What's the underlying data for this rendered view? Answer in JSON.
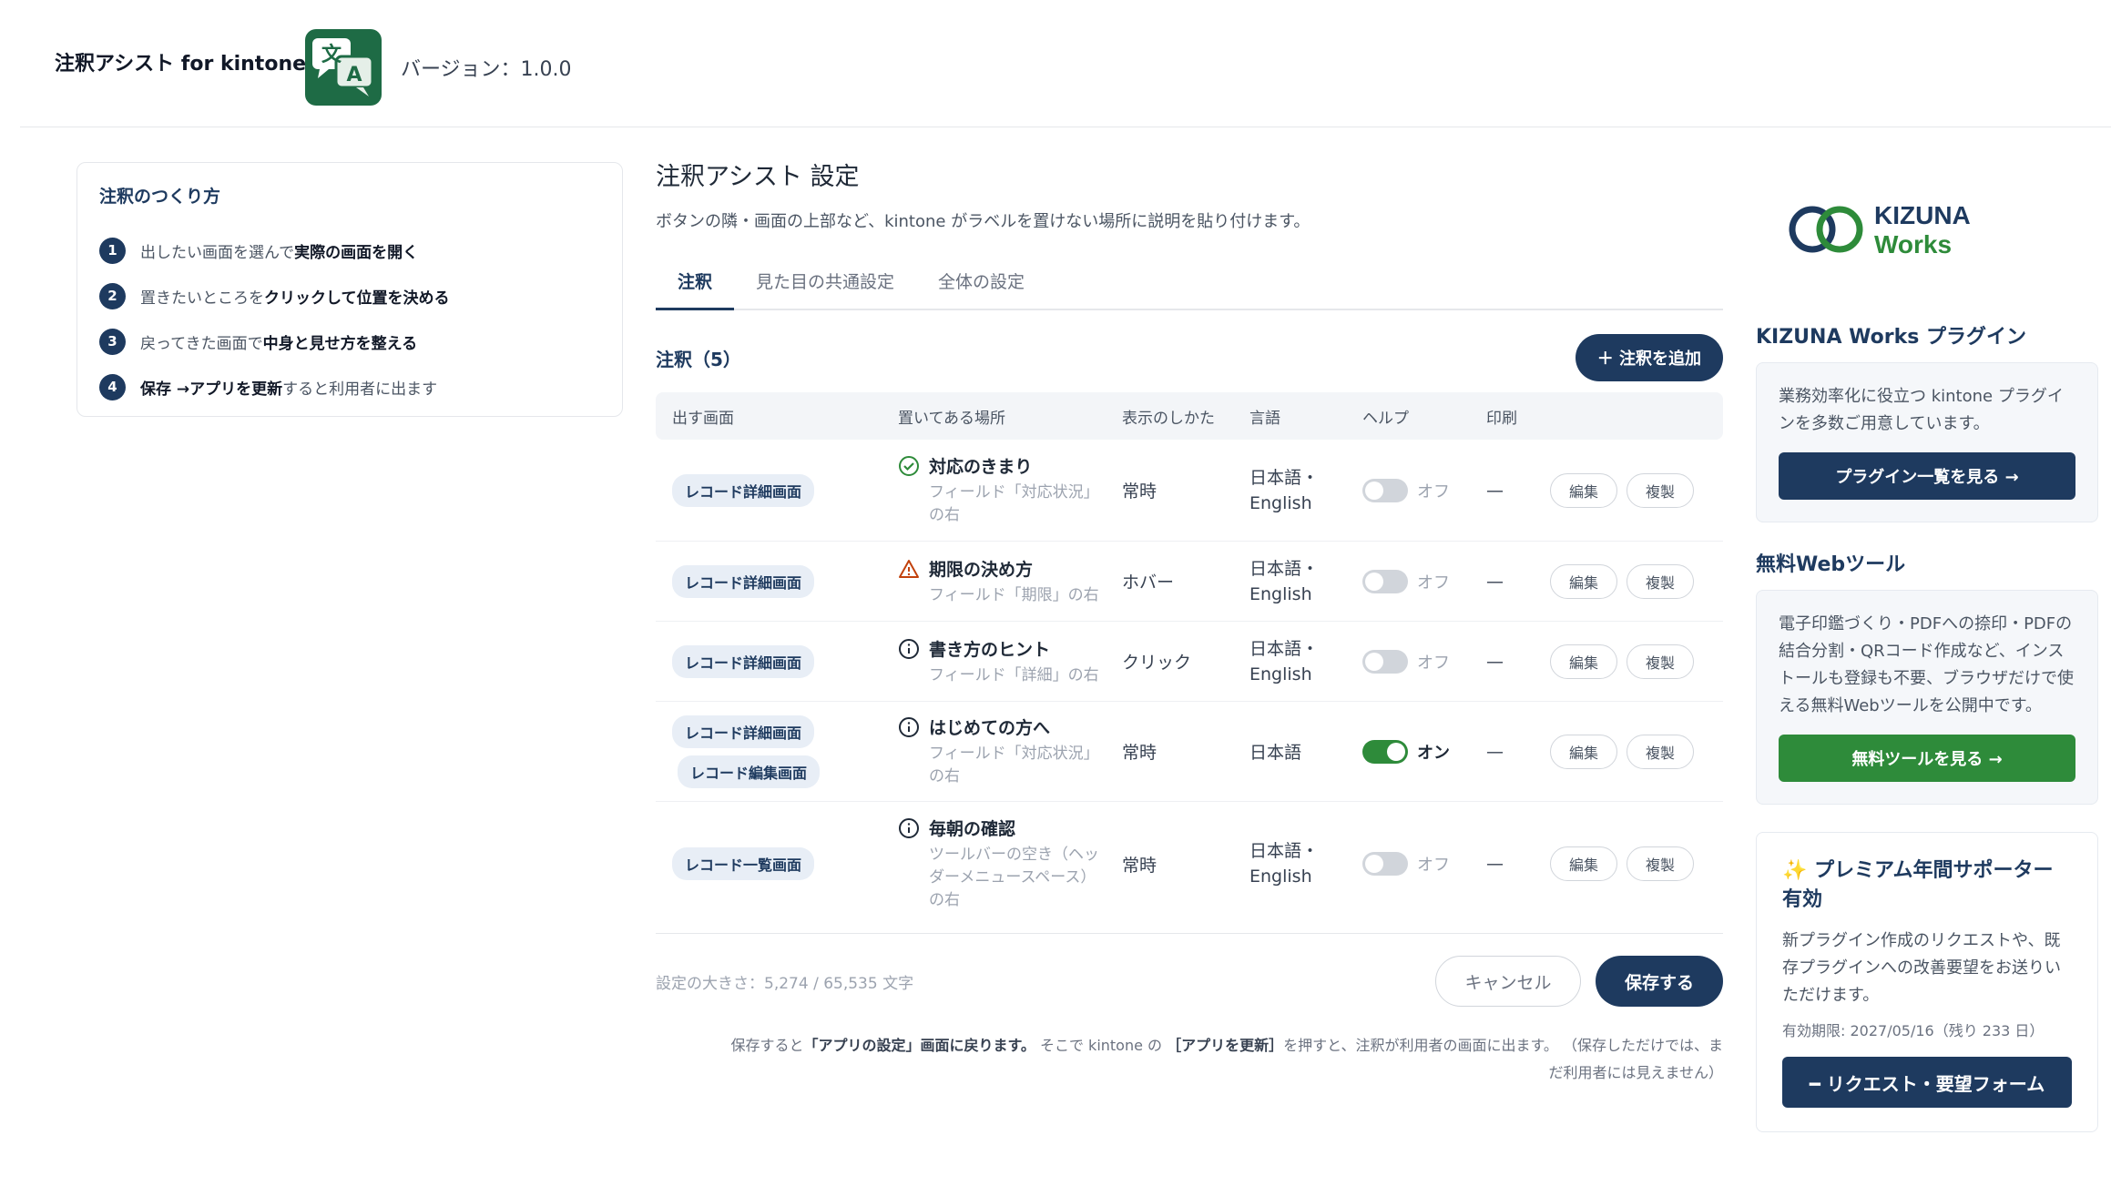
{
  "header": {
    "app_title": "注釈アシスト for kintone",
    "logo_glyph_1": "文",
    "logo_glyph_2": "A",
    "version": "バージョン：1.0.0"
  },
  "guide": {
    "title": "注釈のつくり方",
    "steps": [
      {
        "num": "1",
        "pre": "出したい画面を選んで",
        "bold": "実際の画面を開く",
        "post": ""
      },
      {
        "num": "2",
        "pre": "置きたいところを",
        "bold": "クリックして位置を決める",
        "post": ""
      },
      {
        "num": "3",
        "pre": "戻ってきた画面で",
        "bold": "中身と見せ方を整える",
        "post": ""
      },
      {
        "num": "4",
        "pre": "",
        "bold": "保存 →アプリを更新",
        "post": "すると利用者に出ます"
      }
    ]
  },
  "main": {
    "title": "注釈アシスト 設定",
    "description": "ボタンの隣・画面の上部など、kintone がラベルを置けない場所に説明を貼り付けます。",
    "tabs": [
      "注釈",
      "見た目の共通設定",
      "全体の設定"
    ],
    "section_title": "注釈（5）",
    "add_button": "＋ 注釈を追加",
    "columns": [
      "出す画面",
      "置いてある場所",
      "表示のしかた",
      "言語",
      "ヘルプ",
      "印刷"
    ],
    "rows": [
      {
        "screens": [
          "レコード詳細画面"
        ],
        "icon": "check-circle-icon",
        "name": "対応のきまり",
        "sub": "フィールド「対応状況」の右",
        "display": "常時",
        "lang": "日本語・English",
        "help_on": false,
        "help": "オフ",
        "print": "—",
        "edit": "編集",
        "copy": "複製"
      },
      {
        "screens": [
          "レコード詳細画面"
        ],
        "icon": "warning-icon",
        "name": "期限の決め方",
        "sub": "フィールド「期限」の右",
        "display": "ホバー",
        "lang": "日本語・English",
        "help_on": false,
        "help": "オフ",
        "print": "—",
        "edit": "編集",
        "copy": "複製"
      },
      {
        "screens": [
          "レコード詳細画面"
        ],
        "icon": "info-icon",
        "name": "書き方のヒント",
        "sub": "フィールド「詳細」の右",
        "display": "クリック",
        "lang": "日本語・English",
        "help_on": false,
        "help": "オフ",
        "print": "—",
        "edit": "編集",
        "copy": "複製"
      },
      {
        "screens": [
          "レコード詳細画面",
          "レコード編集画面"
        ],
        "icon": "info-icon",
        "name": "はじめての方へ",
        "sub": "フィールド「対応状況」の右",
        "display": "常時",
        "lang": "日本語",
        "help_on": true,
        "help": "オン",
        "print": "—",
        "edit": "編集",
        "copy": "複製"
      },
      {
        "screens": [
          "レコード一覧画面"
        ],
        "icon": "info-icon",
        "name": "毎朝の確認",
        "sub": "ツールバーの空き（ヘッダーメニュースペース）の右",
        "display": "常時",
        "lang": "日本語・English",
        "help_on": false,
        "help": "オフ",
        "print": "—",
        "edit": "編集",
        "copy": "複製"
      }
    ],
    "size_text": "設定の大きさ：5,274 / 65,535 文字",
    "cancel": "キャンセル",
    "save": "保存する",
    "note_1": "保存すると",
    "note_2": "「アプリの設定」画面に戻ります。",
    "note_3": " そこで kintone の ",
    "note_4": "［アプリを更新］",
    "note_5": "を押すと、注釈が利用者の画面に出ます。 （保存しただけでは、ま",
    "note_6": "だ利用者には見えません）"
  },
  "sidebar": {
    "brand_1": "KIZUNA",
    "brand_2": "Works",
    "plugin_heading": "KIZUNA Works プラグイン",
    "plugin_text": "業務効率化に役立つ kintone プラグインを多数ご用意しています。",
    "plugin_button": "プラグイン一覧を見る →",
    "tools_heading": "無料Webツール",
    "tools_text": "電子印鑑づくり・PDFへの捺印・PDFの結合分割・QRコード作成など、インストールも登録も不要、ブラウザだけで使える無料Webツールを公開中です。",
    "tools_button": "無料ツールを見る →",
    "premium_icon": "✨",
    "premium_title": "プレミアム年間サポーター有効",
    "premium_text": "新プラグイン作成のリクエストや、既存プラグインへの改善要望をお送りいただけます。",
    "premium_expiry": "有効期限: 2027/05/16（残り 233 日）",
    "premium_button": "━ リクエスト・要望フォーム"
  },
  "colors": {
    "navy": "#1e3a5f",
    "green": "#2e8b3a",
    "brand_green": "#1e6b45"
  }
}
